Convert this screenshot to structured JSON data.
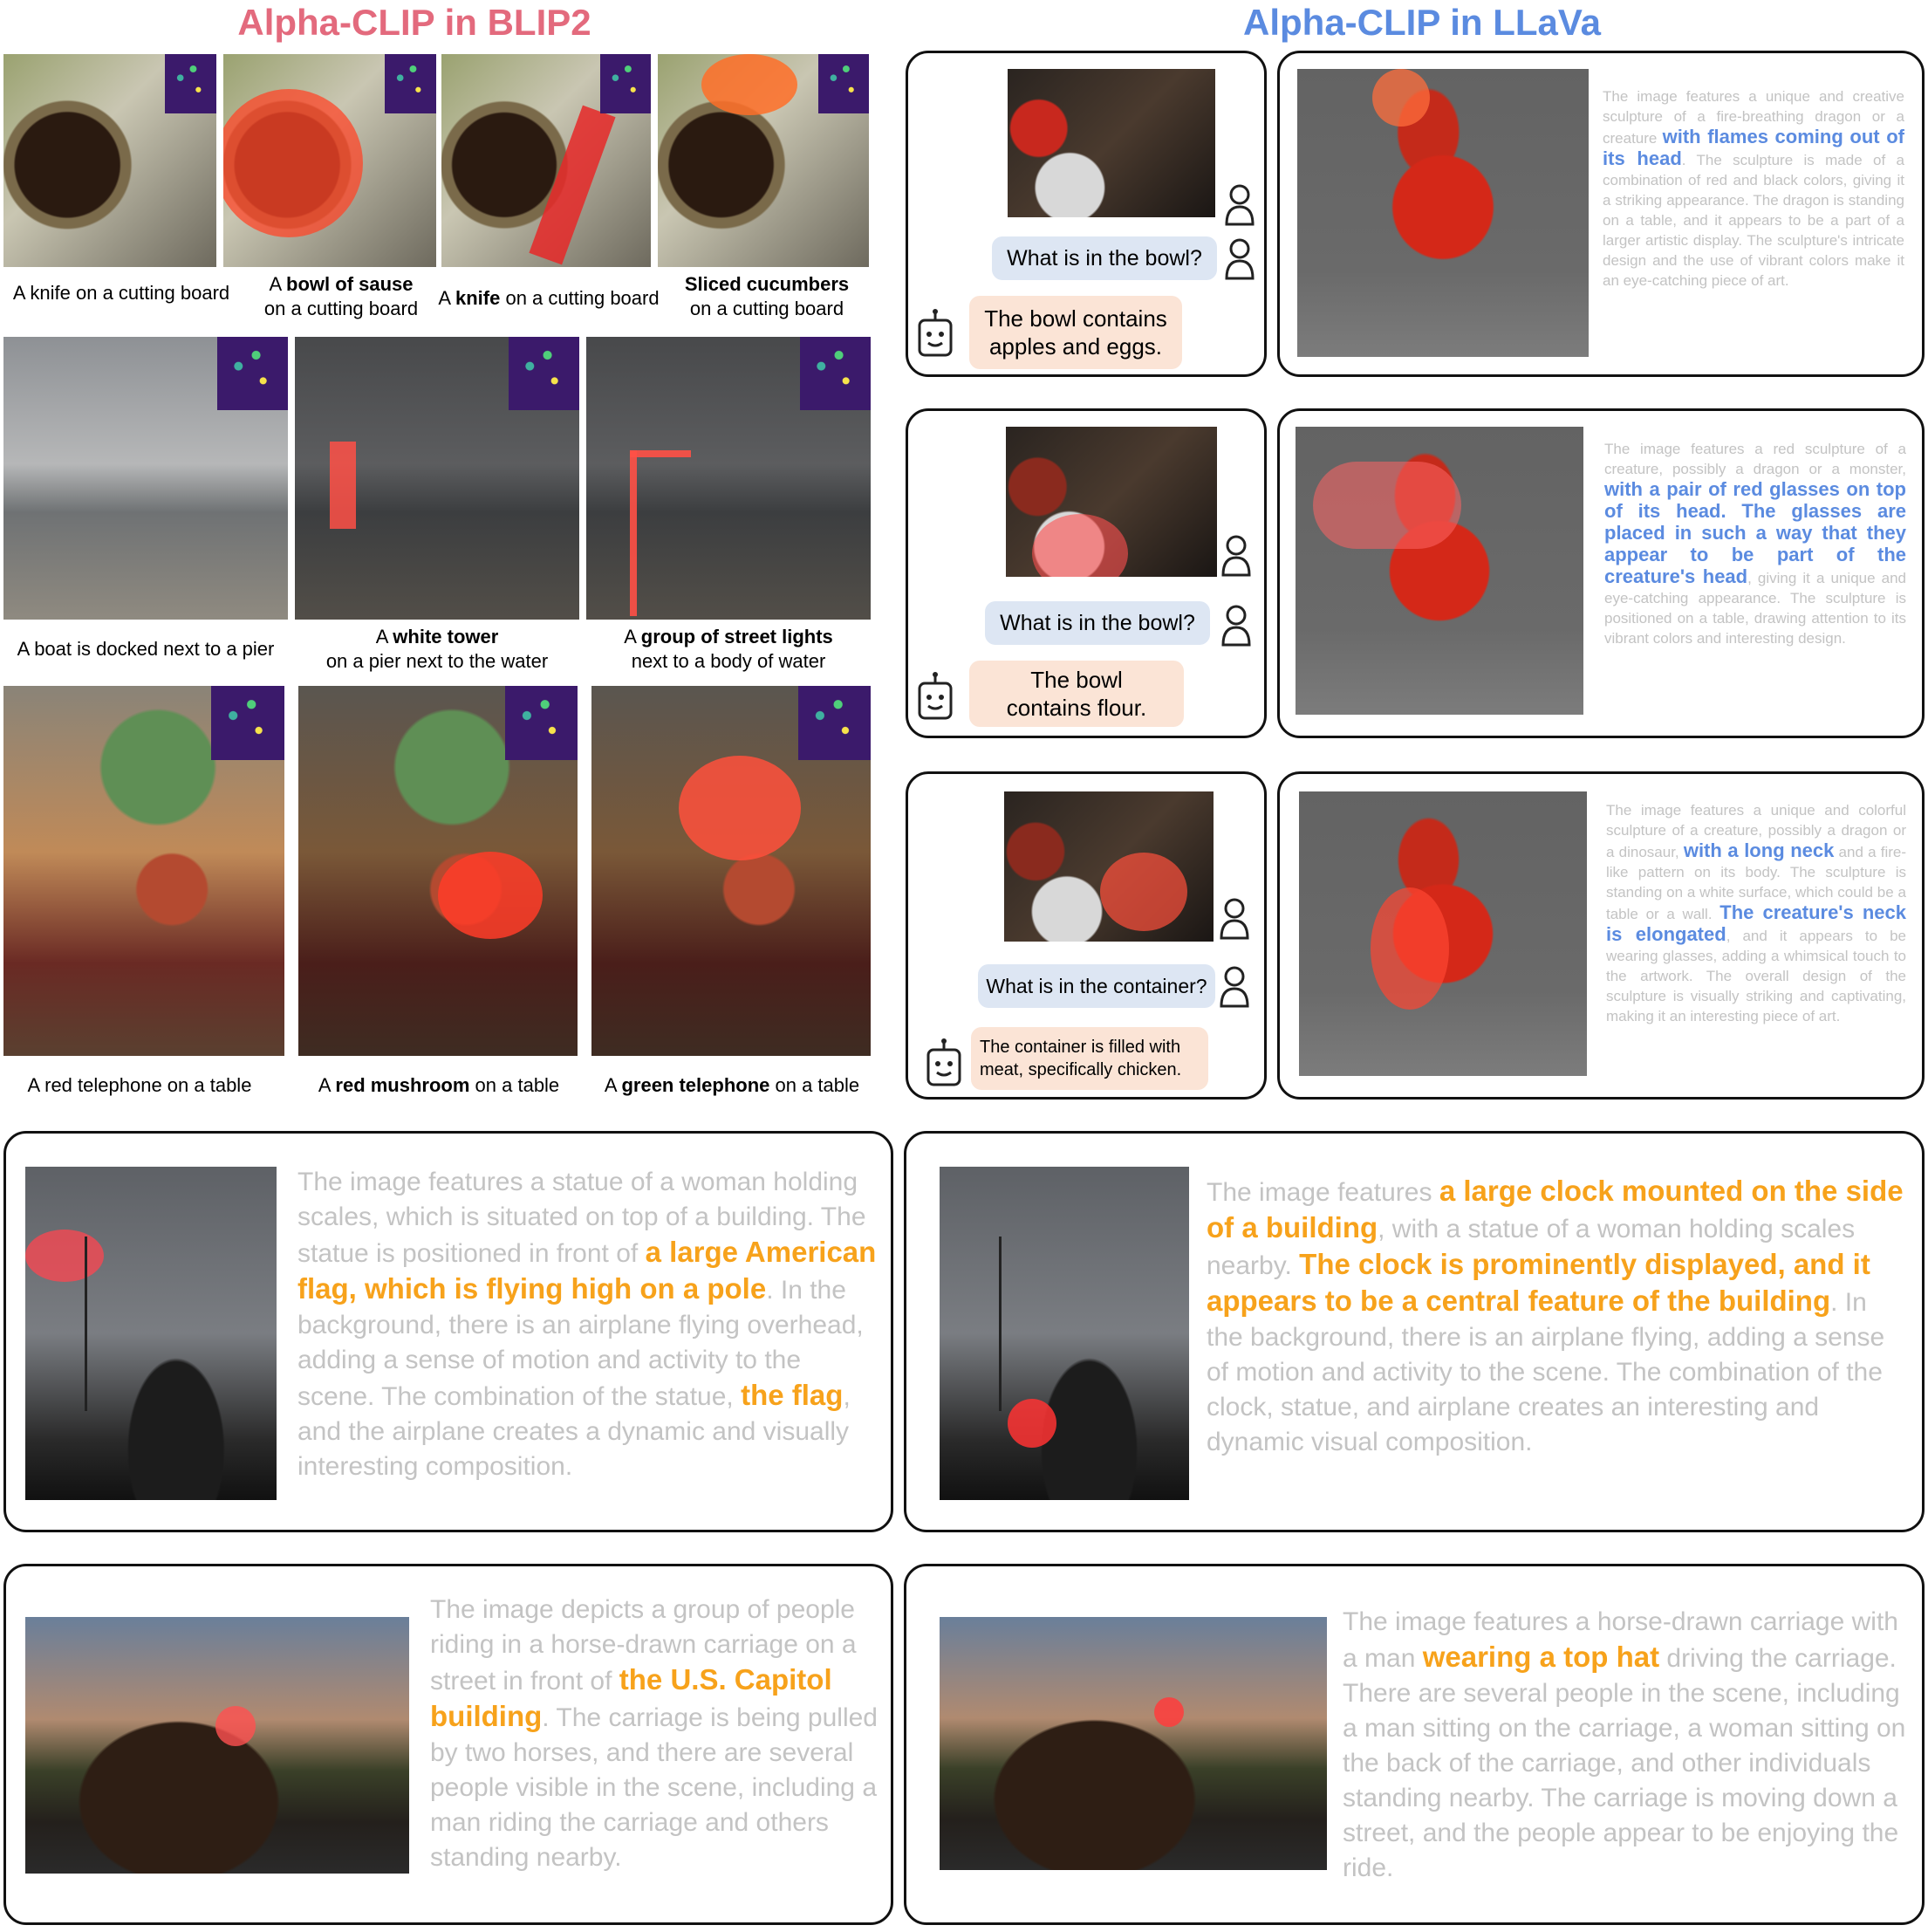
{
  "titles": {
    "left": "Alpha-CLIP in BLIP2",
    "right": "Alpha-CLIP in LLaVa"
  },
  "blip2": {
    "row1": [
      {
        "pre": "A knife on a cutting board",
        "bold": "",
        "post": ""
      },
      {
        "pre": "A ",
        "bold": "bowl of sause",
        "post": "on a cutting board"
      },
      {
        "pre": "A ",
        "bold": "knife",
        "post": " on a cutting board"
      },
      {
        "pre": "",
        "bold": "Sliced cucumbers",
        "post": "on a cutting board"
      }
    ],
    "row2": [
      {
        "pre": "A boat is docked next to a pier",
        "bold": "",
        "post": ""
      },
      {
        "pre": "A ",
        "bold": "white tower",
        "post": "on a pier next to the water"
      },
      {
        "pre": "A ",
        "bold": "group of street lights",
        "post": "next to a body of water"
      }
    ],
    "row3": [
      {
        "pre": "A red telephone on a table",
        "bold": "",
        "post": ""
      },
      {
        "pre": "A ",
        "bold": "red mushroom",
        "post": " on a table"
      },
      {
        "pre": "A ",
        "bold": "green telephone",
        "post": " on a table"
      }
    ]
  },
  "llava_chats": [
    {
      "question": "What is in the bowl?",
      "answer": "The bowl contains apples and eggs."
    },
    {
      "question": "What is in the bowl?",
      "answer": "The bowl contains flour."
    },
    {
      "question": "What is in the container?",
      "answer": "The container is filled with meat, specifically chicken."
    }
  ],
  "llava_dragon": [
    {
      "a": "The image features a unique and creative sculpture of a fire-breathing dragon or a creature ",
      "b": "with flames coming out of its head",
      "c": ". The sculpture is made of a combination of red and black colors, giving it a striking appearance. The dragon is standing on a table, and it appears to be a part of a larger artistic display. The sculpture's intricate design and the use of vibrant colors make it an eye-catching piece of art."
    },
    {
      "a": "The image features a red sculpture of a creature, possibly a dragon or a monster, ",
      "b": "with a pair of red glasses on top of its head. The glasses are placed in such a way that they appear to be part of the creature's head",
      "c": ", giving it a unique and eye-catching appearance. The sculpture is positioned on a table, drawing attention to its vibrant colors and interesting design."
    },
    {
      "a": "The image features a unique and colorful sculpture of a creature, possibly a dragon or a dinosaur, ",
      "b": "with a long neck",
      "c": " and a fire-like pattern on its body. The sculpture is standing on a white surface, which could be a table or a wall. ",
      "d": "The creature's neck is elongated",
      "e": ", and it appears to be wearing glasses, adding a whimsical touch to the artwork. The overall design of the sculpture is visually striking and captivating, making it an interesting piece of art."
    }
  ],
  "bottom": [
    {
      "a": "The image features a statue of a woman holding scales, which is situated on top of a building. The statue is positioned in front of ",
      "b": "a large American flag, which is flying high on a pole",
      "c": ". In the background, there is an airplane flying overhead, adding a sense of motion and activity to the scene. The combination of the statue, ",
      "d": "the flag",
      "e": ", and the airplane creates a dynamic and visually interesting composition."
    },
    {
      "a": "The image features ",
      "b": "a large clock mounted on the side of a building",
      "c": ", with a statue of a woman holding scales nearby. ",
      "d": "The clock is prominently displayed, and it appears to be a central feature of the building",
      "e": ". In the background, there is an airplane flying, adding a sense of motion and activity to the scene. The combination of the clock, statue, and airplane creates an interesting and dynamic visual composition."
    },
    {
      "a": "The image depicts a group of people riding in a horse-drawn carriage on a street in front of ",
      "b": "the U.S. Capitol building",
      "c": ". The carriage is being pulled by two horses, and there are several people visible in the scene, including a man riding the carriage and others standing nearby.",
      "d": "",
      "e": ""
    },
    {
      "a": "The image features a horse-drawn carriage with a man ",
      "b": "wearing a top hat",
      "c": " driving the carriage. There are several people in the scene, including a man sitting on the carriage, a woman sitting on the back of the carriage, and other individuals standing nearby. The carriage is moving down a street, and the people appear to be enjoying the ride.",
      "d": "",
      "e": ""
    }
  ]
}
